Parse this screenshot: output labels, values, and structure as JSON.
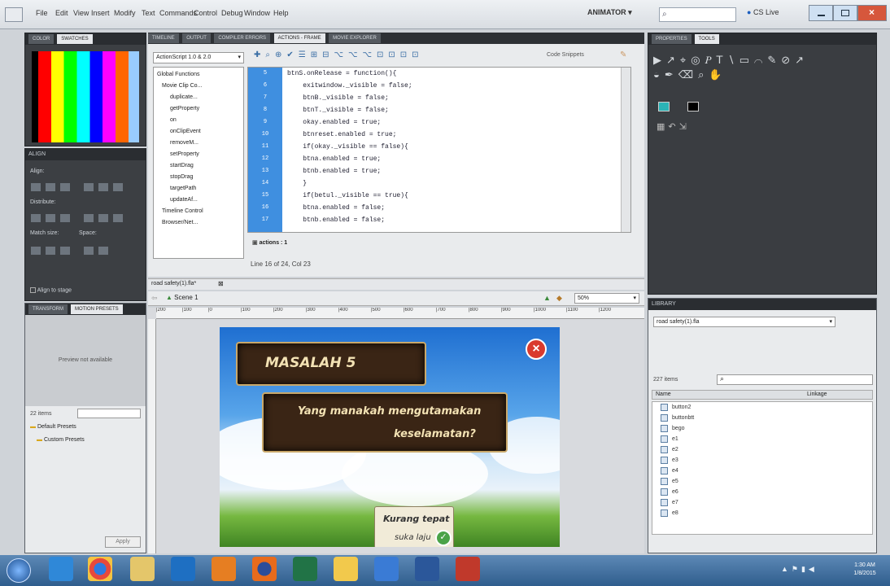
{
  "menu": [
    "File",
    "Edit",
    "View",
    "Insert",
    "Modify",
    "Text",
    "Commands",
    "Control",
    "Debug",
    "Window",
    "Help"
  ],
  "workspace": "ANIMATOR ▾",
  "search_placeholder": "",
  "cs_live": "CS Live",
  "left_panel": {
    "color_tabs": [
      "COLOR",
      "SWATCHES"
    ],
    "align_title": "ALIGN",
    "align_label": "Align:",
    "distribute_label": "Distribute:",
    "match_size_label": "Match size:",
    "space_label": "Space:",
    "align_to_stage": "Align to stage",
    "transform_tabs": [
      "TRANSFORM",
      "MOTION PRESETS"
    ],
    "preview_text": "Preview not available",
    "items_count": "22 items",
    "presets": [
      "Default Presets",
      "Custom Presets"
    ],
    "apply_label": "Apply"
  },
  "top_tabs": [
    "TIMELINE",
    "OUTPUT",
    "COMPILER ERRORS",
    "ACTIONS - FRAME",
    "MOVIE EXPLORER"
  ],
  "actions": {
    "script_version": "ActionScript 1.0 & 2.0",
    "code_snippets": "Code Snippets",
    "tree": [
      "Global Functions",
      "Movie Clip Co...",
      "duplicate...",
      "getProperty",
      "on",
      "onClipEvent",
      "removeM...",
      "setProperty",
      "startDrag",
      "stopDrag",
      "targetPath",
      "updateAf...",
      "Timeline Control",
      "Browser/Net..."
    ],
    "line_numbers": [
      "5",
      "6",
      "7",
      "8",
      "9",
      "10",
      "11",
      "12",
      "13",
      "14",
      "15",
      "16",
      "17"
    ],
    "code_lines": [
      "btnS.onRelease = function(){",
      "    exitwindow._visible = false;",
      "    btnB._visible = false;",
      "    btnT._visible = false;",
      "    okay.enabled = true;",
      "    btnreset.enabled = true;",
      "    if(okay._visible == false){",
      "    btna.enabled = true;",
      "    btnb.enabled = true;",
      "    }",
      "    if(betul._visible == true){",
      "    btna.enabled = false;",
      "    btnb.enabled = false;"
    ],
    "frame_tab": "actions : 1",
    "status": "Line 16 of 24, Col 23"
  },
  "document": {
    "doc_tab": "road safety(1).fla*",
    "scene": "Scene 1",
    "zoom": "50%",
    "ruler": [
      "|200",
      "|100",
      "|0",
      "|100",
      "|200",
      "|300",
      "|400",
      "|500",
      "|600",
      "|700",
      "|800",
      "|900",
      "|1000",
      "|1100",
      "|1200"
    ],
    "stage_title": "MASALAH 5",
    "stage_question_line1": "Yang manakah mengutamakan",
    "stage_question_line2": "keselamatan?",
    "stage_answer_line1": "Kurang tepat",
    "stage_answer_line2": "suka laju"
  },
  "right_panel": {
    "tabs": [
      "PROPERTIES",
      "TOOLS"
    ],
    "library_title": "LIBRARY",
    "library_file": "road safety(1).fla",
    "items_count": "227 items",
    "col_name": "Name",
    "col_linkage": "Linkage",
    "items": [
      "button2",
      "buttonbtt",
      "bego",
      "e1",
      "e2",
      "e3",
      "e4",
      "e5",
      "e6",
      "e7",
      "e8"
    ]
  },
  "taskbar": {
    "time": "1:30 AM",
    "date": "1/8/2015"
  }
}
